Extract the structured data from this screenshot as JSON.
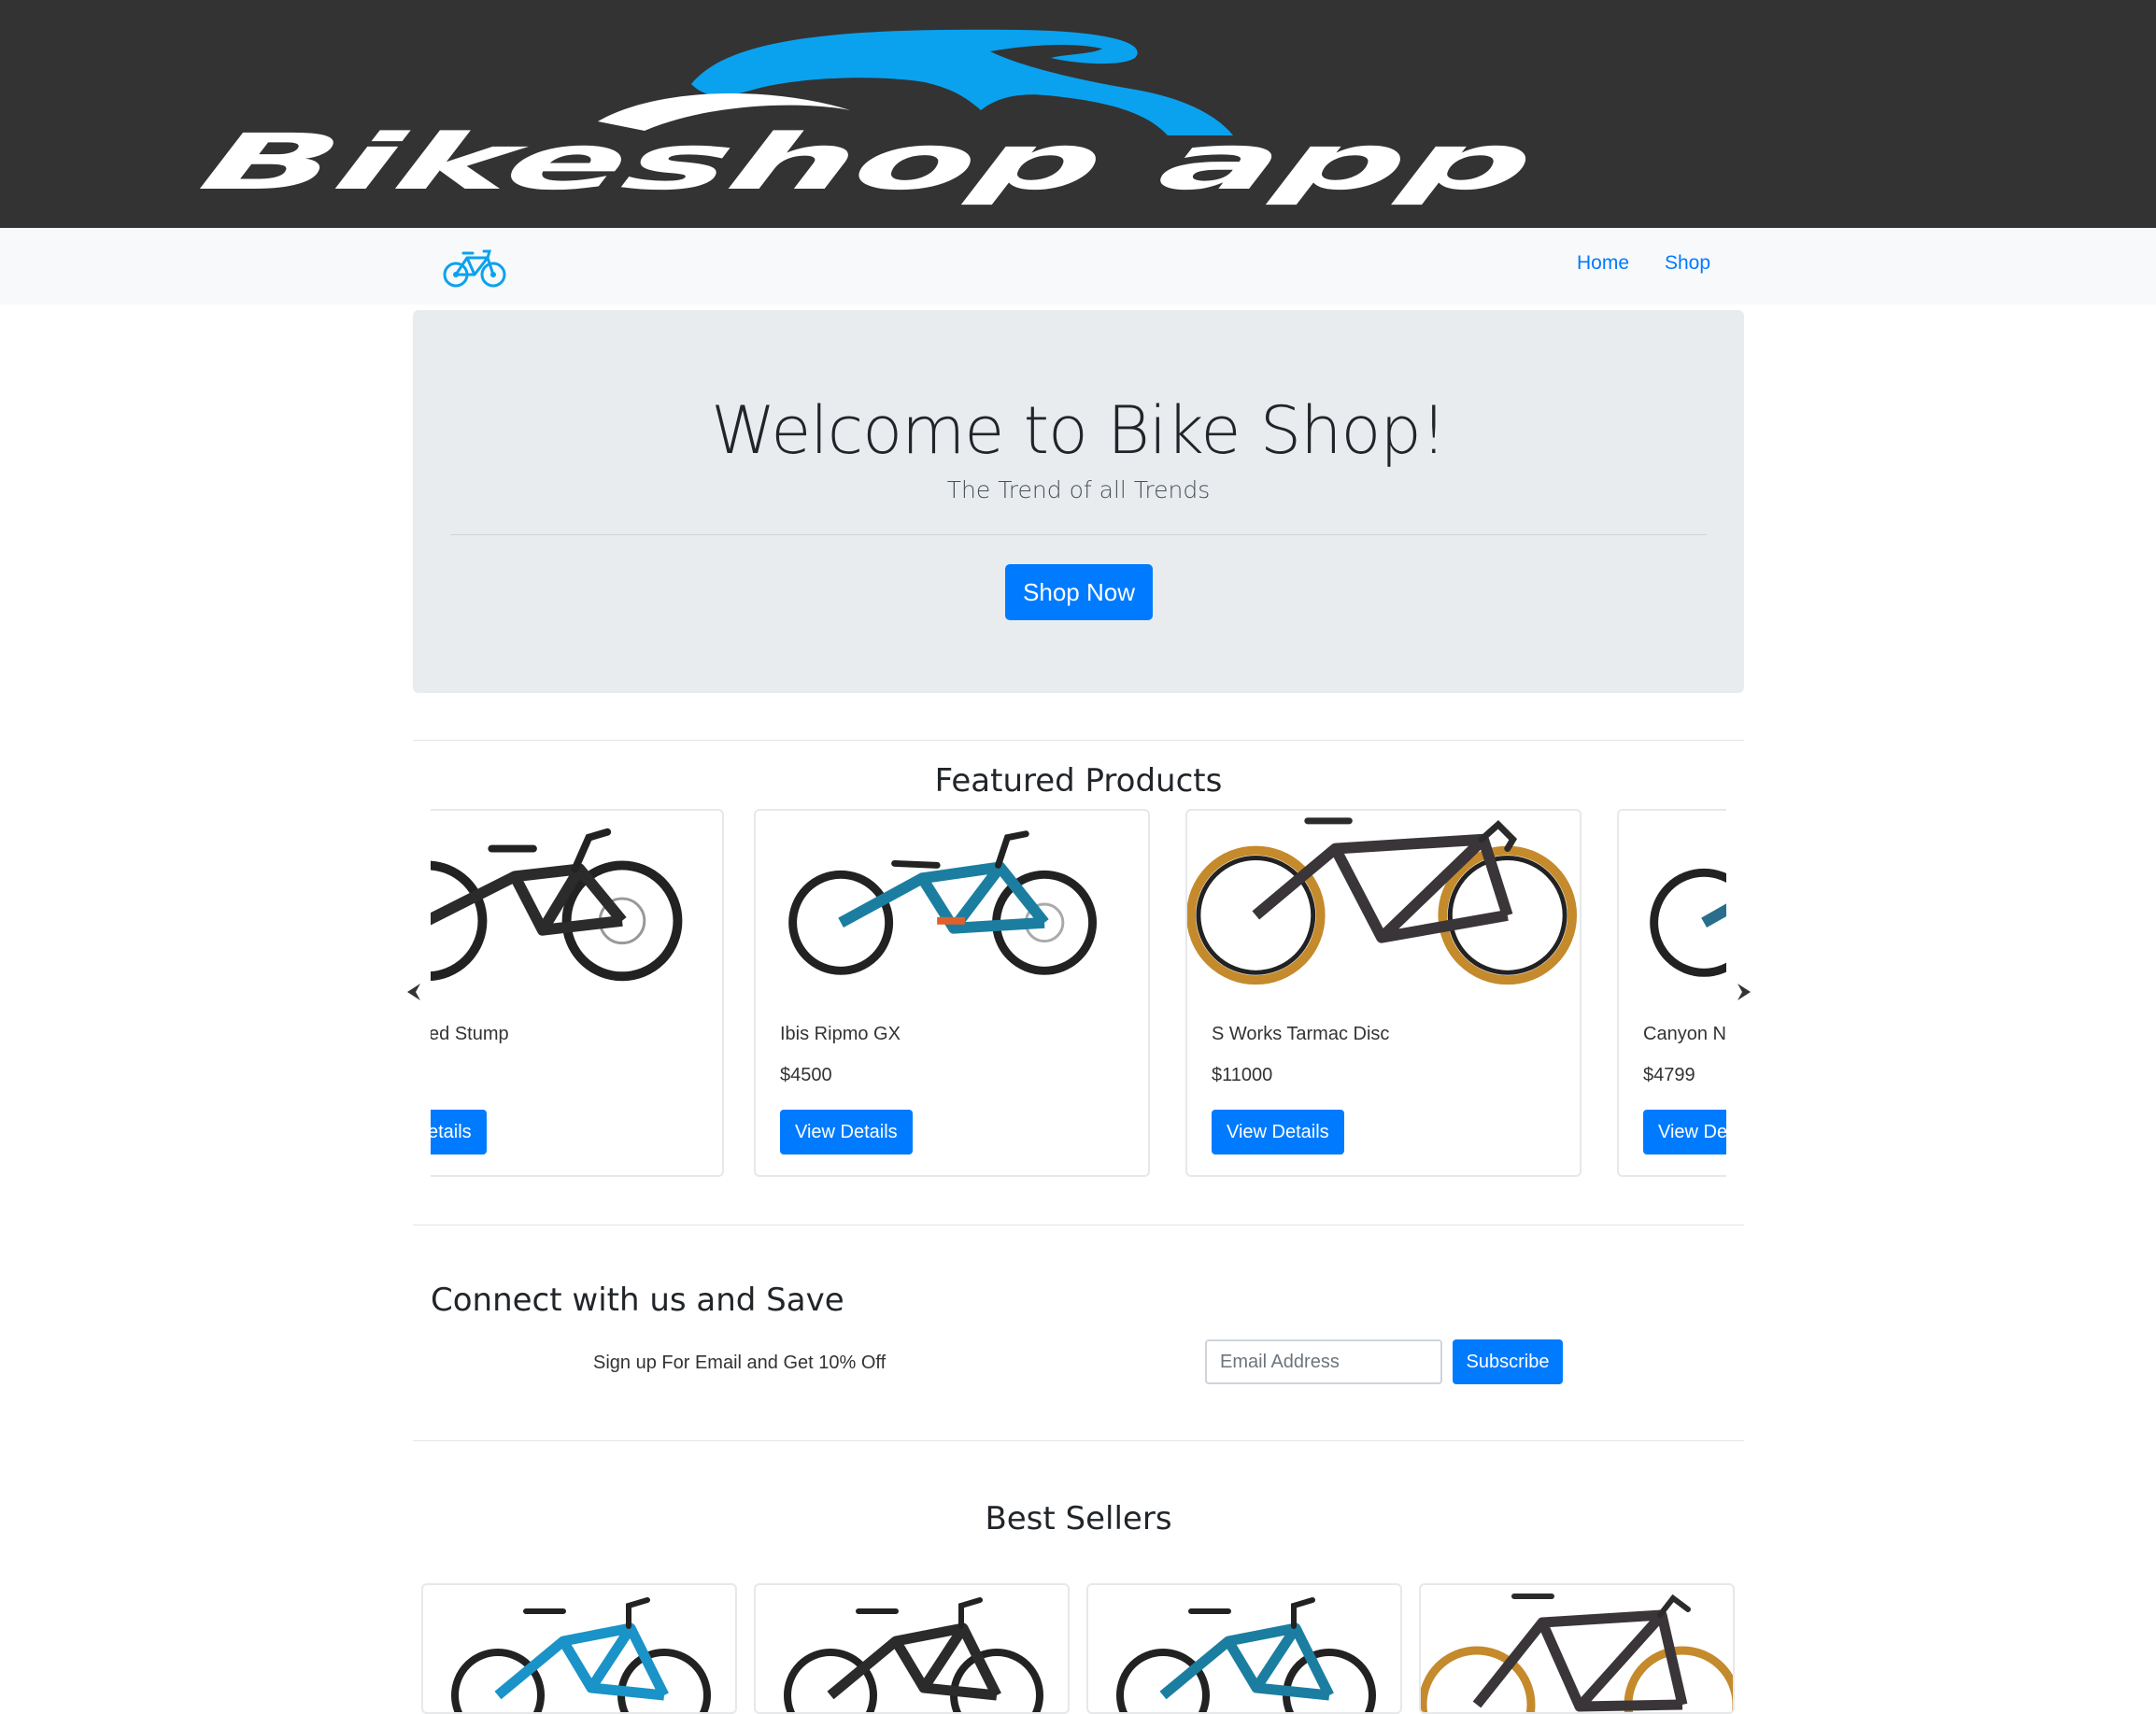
{
  "header": {
    "logo_text": "Bikeshop app"
  },
  "nav": {
    "brand_icon": "bicycle-icon",
    "links": [
      {
        "label": "Home"
      },
      {
        "label": "Shop"
      }
    ]
  },
  "hero": {
    "title": "Welcome to Bike Shop!",
    "subtitle": "The Trend of all Trends",
    "cta_label": "Shop Now"
  },
  "featured": {
    "title": "Featured Products",
    "prev_icon": "chevron-left-icon",
    "next_icon": "chevron-right-icon",
    "products": [
      {
        "name": "Specialized Stump",
        "price": "",
        "button": "View Details"
      },
      {
        "name": "Ibis Ripmo GX",
        "price": "$4500",
        "button": "View Details"
      },
      {
        "name": "S Works Tarmac Disc",
        "price": "$11000",
        "button": "View Details"
      },
      {
        "name": "Canyon Neuron",
        "price": "$4799",
        "button": "View Details"
      }
    ]
  },
  "newsletter": {
    "title": "Connect with us and Save",
    "text": "Sign up For Email and Get 10% Off",
    "email_placeholder": "Email Address",
    "button": "Subscribe"
  },
  "best_sellers": {
    "title": "Best Sellers"
  },
  "colors": {
    "primary": "#007bff",
    "banner_bg": "#333333",
    "logo_blue": "#0aa2ee",
    "jumbo_bg": "#e9ecef"
  }
}
